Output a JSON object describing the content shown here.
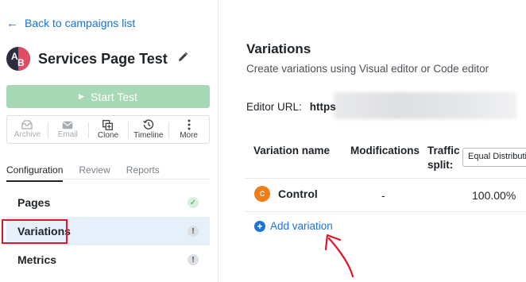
{
  "back_link": "Back to campaigns list",
  "campaign": {
    "avatar_letters": [
      "A",
      "B"
    ],
    "title": "Services Page Test"
  },
  "start_button": "Start Test",
  "toolbar": [
    {
      "label": "Archive",
      "icon": "archive-icon",
      "disabled": true
    },
    {
      "label": "Email",
      "icon": "email-icon",
      "disabled": true
    },
    {
      "label": "Clone",
      "icon": "clone-icon",
      "disabled": false
    },
    {
      "label": "Timeline",
      "icon": "timeline-icon",
      "disabled": false
    },
    {
      "label": "More",
      "icon": "more-icon",
      "disabled": false
    }
  ],
  "tabs": [
    {
      "label": "Configuration",
      "active": true
    },
    {
      "label": "Review",
      "active": false
    },
    {
      "label": "Reports",
      "active": false
    }
  ],
  "nav": [
    {
      "label": "Pages",
      "status": "complete",
      "status_glyph": "✓"
    },
    {
      "label": "Variations",
      "status": "warning",
      "status_glyph": "!",
      "active": true
    },
    {
      "label": "Metrics",
      "status": "warning",
      "status_glyph": "!"
    }
  ],
  "variations": {
    "title": "Variations",
    "subtitle": "Create variations using Visual editor or Code editor",
    "editor_url_label": "Editor URL:",
    "editor_url_value": "https",
    "columns": [
      "Variation name",
      "Modifications",
      "Traffic split:"
    ],
    "split_select": "Equal Distribution",
    "rows": [
      {
        "badge": "C",
        "name": "Control",
        "modifications": "-",
        "split": "100.00%"
      }
    ],
    "add_label": "Add variation"
  },
  "colors": {
    "accent": "#1a73d6",
    "start_button": "#a8d9b7",
    "highlight": "#e3142a",
    "control_badge": "#f07d1a",
    "active_nav_bg": "#e6f0fb"
  }
}
